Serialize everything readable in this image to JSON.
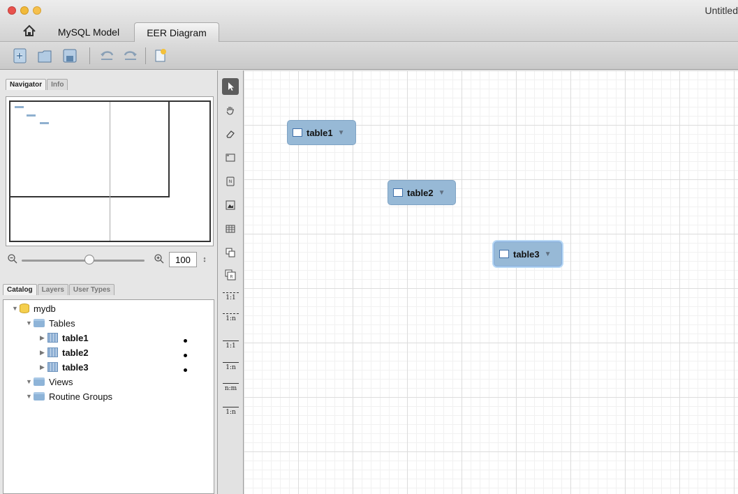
{
  "window": {
    "title": "Untitled"
  },
  "tabs": [
    {
      "label": "MySQL Model"
    },
    {
      "label": "EER Diagram"
    }
  ],
  "toolbar": {
    "buttons": [
      "add-model-icon",
      "open-icon",
      "save-icon",
      "undo-icon",
      "redo-icon",
      "new-icon"
    ]
  },
  "navigator_panel": {
    "tabs": [
      {
        "label": "Navigator"
      },
      {
        "label": "Info"
      }
    ],
    "zoom": {
      "value": "100",
      "slider_level": 0.55
    }
  },
  "catalog_panel": {
    "tabs": [
      {
        "label": "Catalog"
      },
      {
        "label": "Layers"
      },
      {
        "label": "User Types"
      }
    ],
    "tree": {
      "schema": "mydb",
      "tables_label": "Tables",
      "tables": [
        {
          "label": "table1"
        },
        {
          "label": "table2"
        },
        {
          "label": "table3"
        }
      ],
      "views_label": "Views",
      "routines_label": "Routine Groups"
    }
  },
  "tools": {
    "relationships": [
      {
        "label": "1:1"
      },
      {
        "label": "1:n"
      },
      {
        "label": "1:1"
      },
      {
        "label": "1:n"
      },
      {
        "label": "n:m"
      },
      {
        "label": "1:n"
      }
    ]
  },
  "diagram": {
    "entities": [
      {
        "label": "table1"
      },
      {
        "label": "table2"
      },
      {
        "label": "table3"
      }
    ]
  },
  "colors": {
    "entity_fill": "#97b9d6",
    "selected_glow": "#b8d8f4",
    "folder": "#8eb4d8",
    "db": "#f5cf4e"
  }
}
